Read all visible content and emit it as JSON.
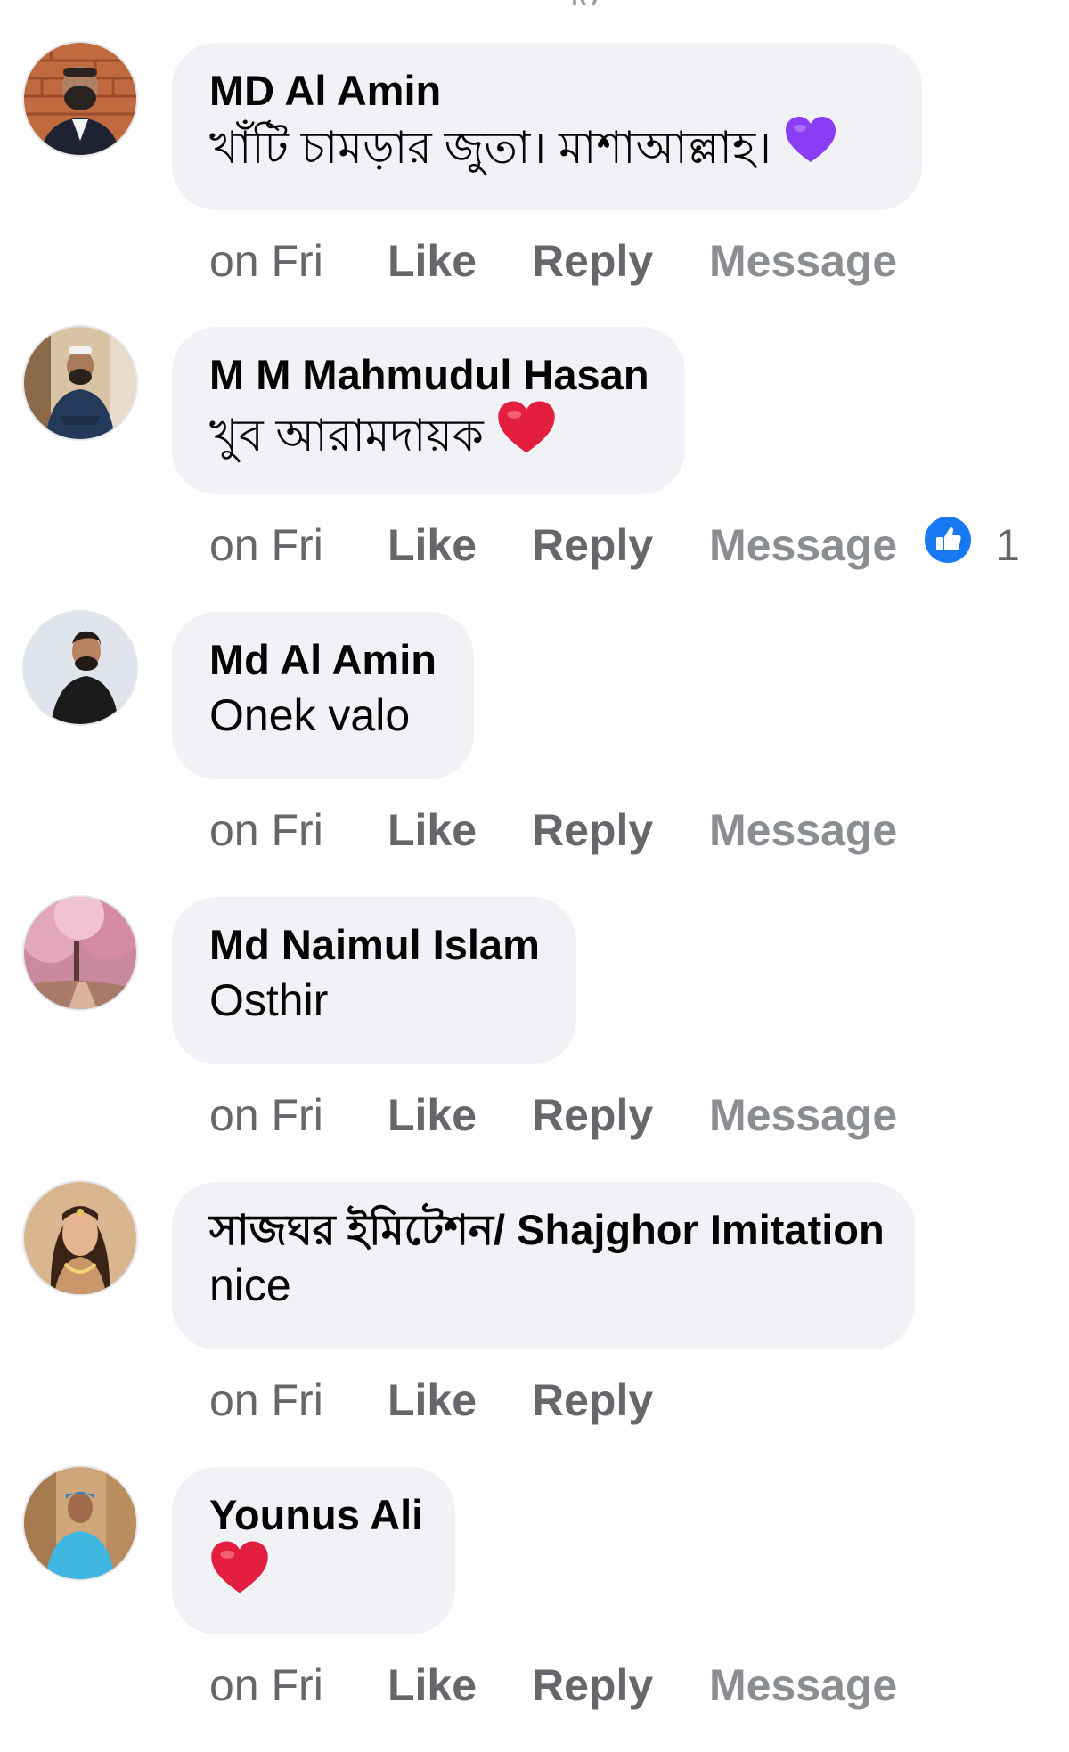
{
  "top_fragment": "ly",
  "comments": [
    {
      "author": "MD Al Amin",
      "text": "খাঁটি চামড়ার জুতা। মাশাআল্লাহ।",
      "emoji": "purple-heart",
      "time": "on Fri",
      "like": "Like",
      "reply": "Reply",
      "message": "Message"
    },
    {
      "author": "M M Mahmudul Hasan",
      "text": "খুব আরামদায়ক",
      "emoji": "red-heart",
      "time": "on Fri",
      "like": "Like",
      "reply": "Reply",
      "message": "Message",
      "reaction_count": "1"
    },
    {
      "author": "Md Al Amin",
      "text": "Onek valo",
      "time": "on Fri",
      "like": "Like",
      "reply": "Reply",
      "message": "Message"
    },
    {
      "author": "Md Naimul Islam",
      "text": "Osthir",
      "time": "on Fri",
      "like": "Like",
      "reply": "Reply",
      "message": "Message"
    },
    {
      "author": "সাজঘর ইমিটেশন/ Shajghor Imitation",
      "text": "nice",
      "time": "on Fri",
      "like": "Like",
      "reply": "Reply"
    },
    {
      "author": "Younus Ali",
      "text": "",
      "emoji": "red-heart",
      "time": "on Fri",
      "like": "Like",
      "reply": "Reply",
      "message": "Message"
    }
  ],
  "colors": {
    "bubble": "#f0f2f5",
    "meta_text": "#65676b",
    "message_link": "#8a8d91",
    "like_badge": "#1877f2",
    "heart_red": "#e41e3f",
    "heart_purple": "#8b3cf6"
  }
}
